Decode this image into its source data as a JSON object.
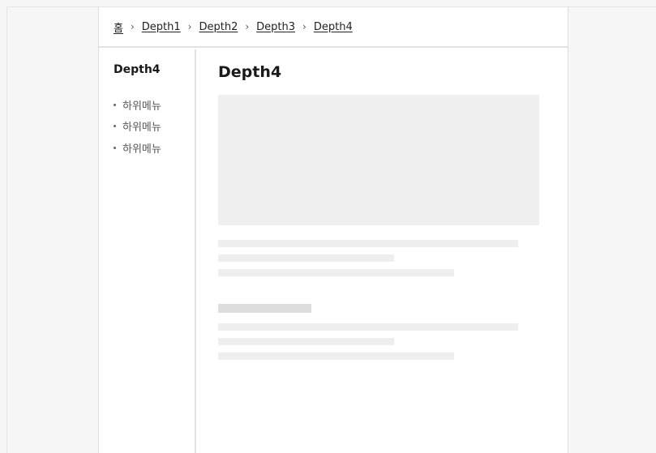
{
  "breadcrumb": {
    "home": "홈",
    "items": [
      "Depth1",
      "Depth2",
      "Depth3",
      "Depth4"
    ],
    "separator": "›"
  },
  "sidebar": {
    "title": "Depth4",
    "items": [
      {
        "label": "하위메뉴"
      },
      {
        "label": "하위메뉴"
      },
      {
        "label": "하위메뉴"
      }
    ]
  },
  "main": {
    "title": "Depth4"
  },
  "colors": {
    "placeholder": "#efefef",
    "placeholder_dark": "#dddddd",
    "divider": "#e2e2e2"
  }
}
